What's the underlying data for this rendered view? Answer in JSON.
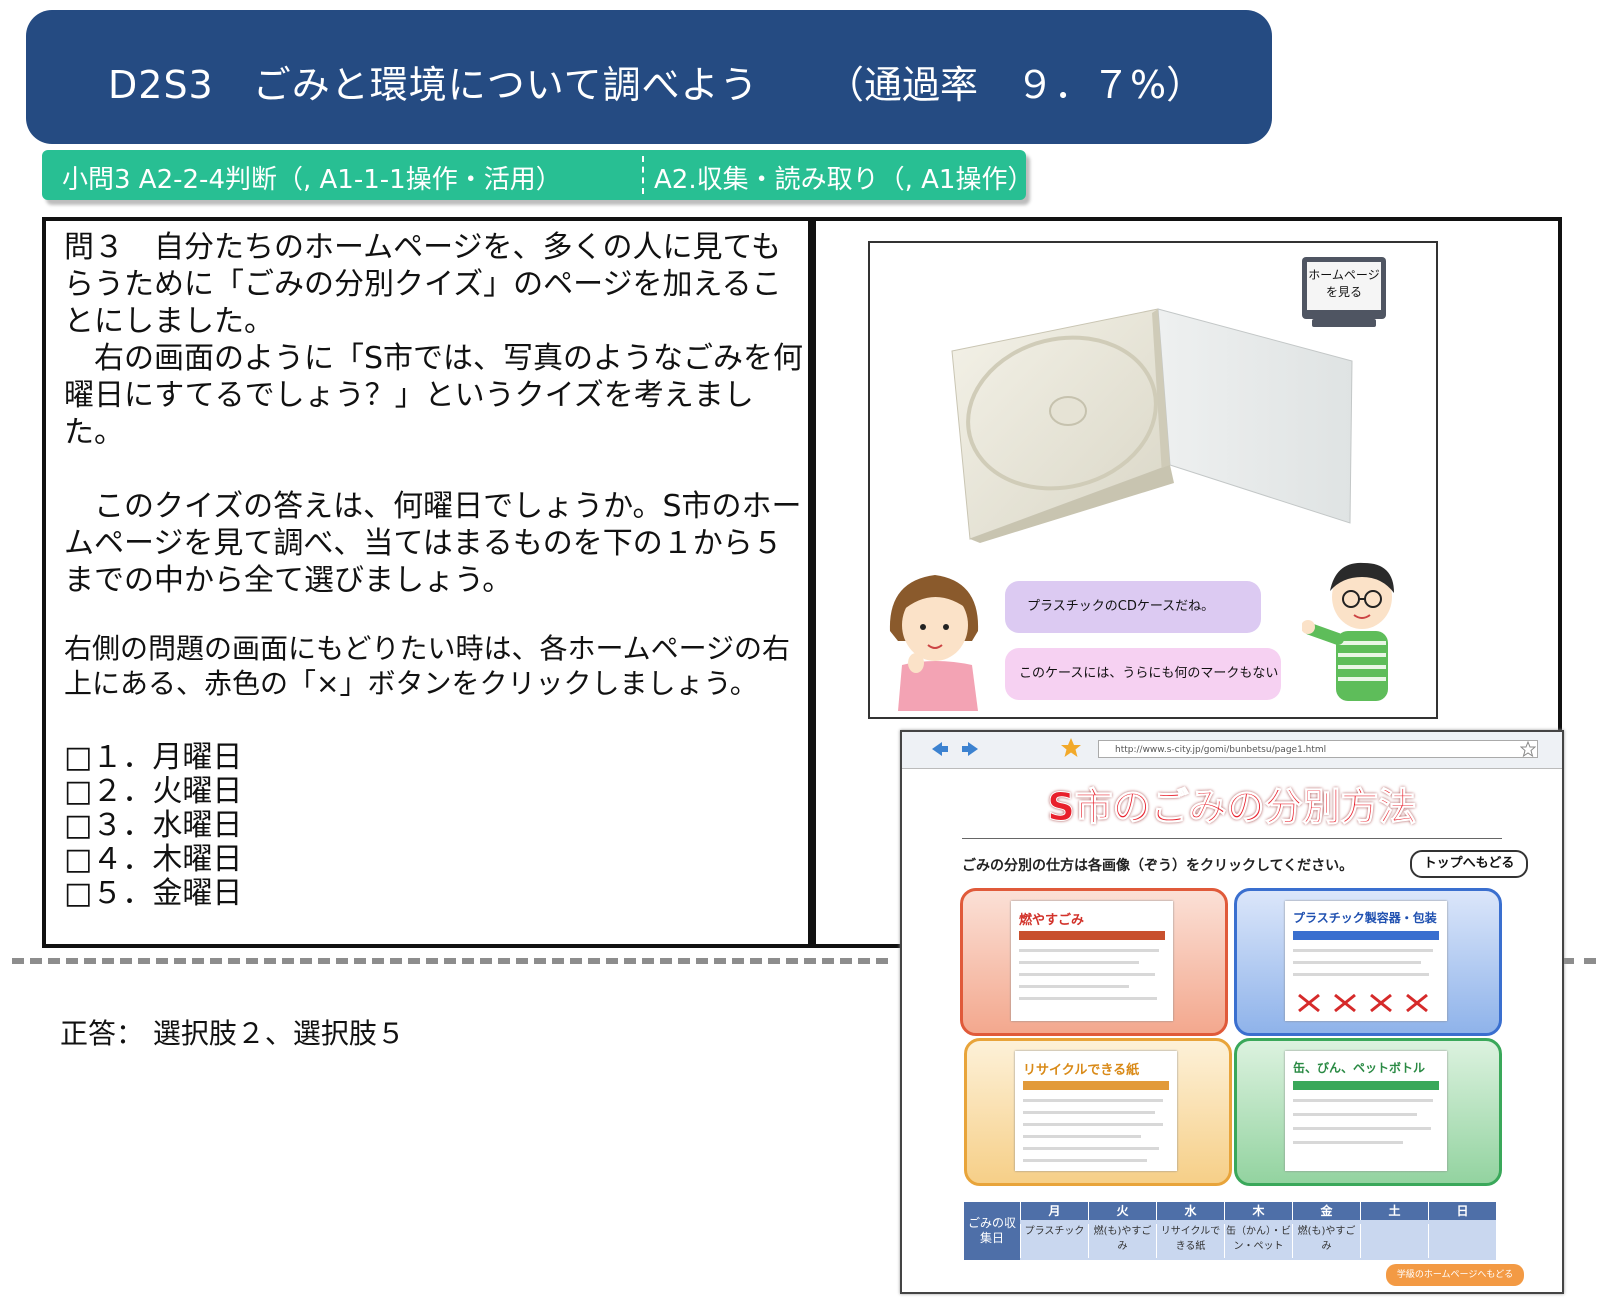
{
  "header": {
    "title": "D2S3　ごみと環境について調べよう",
    "rate": "（通過率　９．７%）"
  },
  "tag": {
    "left": "小問3  A2-2-4判断（, A1-1-1操作・活用）",
    "right": "A2.収集・読み取り（, A1操作）"
  },
  "question": {
    "paragraphs": [
      "問３　自分たちのホームページを、多くの人に見てもらうために「ごみの分別クイズ」のページを加えることにしました。",
      "　右の画面のように「S市では、写真のようなごみを何曜日にすてるでしょう？」というクイズを考えました。",
      "",
      "　このクイズの答えは、何曜日でしょうか。S市のホームページを見て調べ、当てはまるものを下の１から５までの中から全て選びましょう。"
    ],
    "note": "右側の問題の画面にもどりたい時は、各ホームページの右上にある、赤色の「×」ボタンをクリックしましょう。",
    "choices": [
      "□１．月曜日",
      "□２．火曜日",
      "□３．水曜日",
      "□４．木曜日",
      "□５．金曜日"
    ]
  },
  "scene": {
    "home_button": [
      "ホームページ",
      "を見る"
    ],
    "bubble1": "プラスチックのCDケースだね。",
    "bubble2": "このケースには、うらにも何のマークもないよ。"
  },
  "browser": {
    "url": "http://www.s-city.jp/gomi/bunbetsu/page1.html",
    "site_title": "S市のごみの分別方法",
    "instruction": "ごみの分別の仕方は各画像（ぞう）をクリックしてください。",
    "top_button": "トップへもどる",
    "panels": [
      {
        "title": "燃やすごみ",
        "color": "#e05a3a"
      },
      {
        "title": "プラスチック製容器・包装",
        "color": "#3a6fcf"
      },
      {
        "title": "リサイクルできる紙",
        "color": "#e8a43a"
      },
      {
        "title": "缶、びん、ペットボトル",
        "color": "#3aa85a"
      }
    ],
    "schedule": {
      "label": "ごみの収集日",
      "days": [
        "月",
        "火",
        "水",
        "木",
        "金",
        "土",
        "日"
      ],
      "items": [
        "プラスチック",
        "燃(も)やすごみ",
        "リサイクルできる紙",
        "缶（かん）・ビン・ペット",
        "燃(も)やすごみ",
        "",
        ""
      ]
    },
    "school_button": "学級のホームページへもどる"
  },
  "answer": "正答：  選択肢２、選択肢５",
  "colors": {
    "title_bar": "#254b82",
    "tag_bar": "#28bf93",
    "site_title": "#e8202c"
  }
}
